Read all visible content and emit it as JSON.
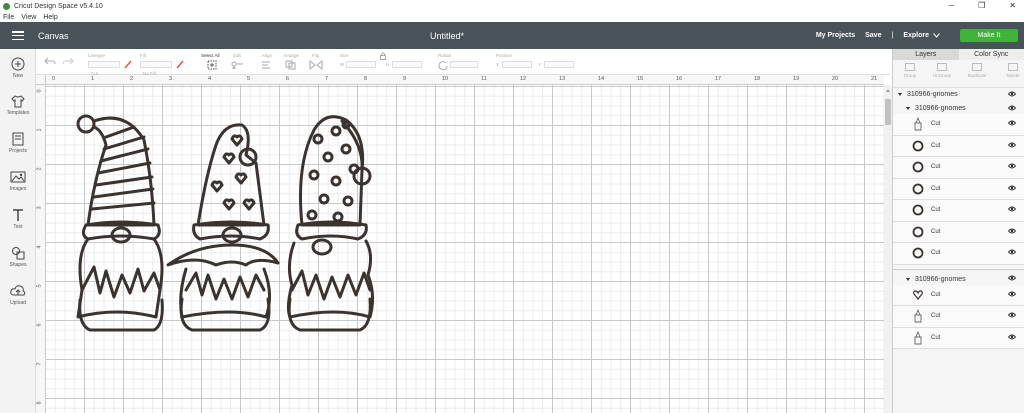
{
  "window": {
    "title": "Cricut Design Space  v5.4.10",
    "controls": [
      "─",
      "❐",
      "✕"
    ]
  },
  "menu": [
    "File",
    "View",
    "Help"
  ],
  "header": {
    "section": "Canvas",
    "document": "Untitled*",
    "my_projects": "My Projects",
    "save": "Save",
    "separator": "|",
    "explore": "Explore",
    "make_it": "Make It"
  },
  "sidebar": [
    {
      "label": "New",
      "icon": "plus-circle-icon"
    },
    {
      "label": "Templates",
      "icon": "shirt-icon"
    },
    {
      "label": "Projects",
      "icon": "projects-icon"
    },
    {
      "label": "Images",
      "icon": "image-icon"
    },
    {
      "label": "Text",
      "icon": "text-icon"
    },
    {
      "label": "Shapes",
      "icon": "shapes-icon"
    },
    {
      "label": "Upload",
      "icon": "upload-icon"
    }
  ],
  "toolbar": {
    "linetype": "Linetype",
    "linetype_value": "Cut",
    "fill": "Fill",
    "fill_value": "No Fill",
    "select_all": "Select All",
    "edit": "Edit",
    "align": "Align",
    "arrange": "Arrange",
    "flip": "Flip",
    "size": "Size",
    "w": "W",
    "h": "H",
    "rotate": "Rotate",
    "position": "Position",
    "x": "X",
    "y": "Y"
  },
  "ruler": {
    "top": [
      "0",
      "1",
      "2",
      "3",
      "4",
      "5",
      "6",
      "7",
      "8",
      "9",
      "10",
      "11",
      "12",
      "13",
      "14",
      "15",
      "16",
      "17",
      "18",
      "19",
      "20",
      "21"
    ],
    "left": [
      "0",
      "1",
      "2",
      "3",
      "4",
      "5",
      "6",
      "7",
      "8"
    ]
  },
  "panel": {
    "tabs": [
      "Layers",
      "Color Sync"
    ],
    "tools": [
      "Group",
      "UnGroup",
      "Duplicate",
      "Delete"
    ],
    "groups": [
      {
        "name": "310966-gnomes",
        "level": 0
      },
      {
        "name": "310966-gnomes",
        "level": 1,
        "layers": [
          {
            "label": "Cut",
            "thumb": "gnome-icon"
          },
          {
            "label": "Cut",
            "thumb": "circle-icon"
          },
          {
            "label": "Cut",
            "thumb": "circle-icon"
          },
          {
            "label": "Cut",
            "thumb": "circle-icon"
          },
          {
            "label": "Cut",
            "thumb": "circle-icon"
          },
          {
            "label": "Cut",
            "thumb": "circle-icon"
          },
          {
            "label": "Cut",
            "thumb": "circle-icon"
          }
        ]
      },
      {
        "name": "310966-gnomes",
        "level": 1,
        "layers": [
          {
            "label": "Cut",
            "thumb": "heart-icon"
          },
          {
            "label": "Cut",
            "thumb": "gnome-icon"
          },
          {
            "label": "Cut",
            "thumb": "gnome-icon"
          }
        ]
      }
    ]
  },
  "colors": {
    "header": "#475259",
    "make_it": "#3fb33a",
    "stroke": "#3a3330"
  }
}
